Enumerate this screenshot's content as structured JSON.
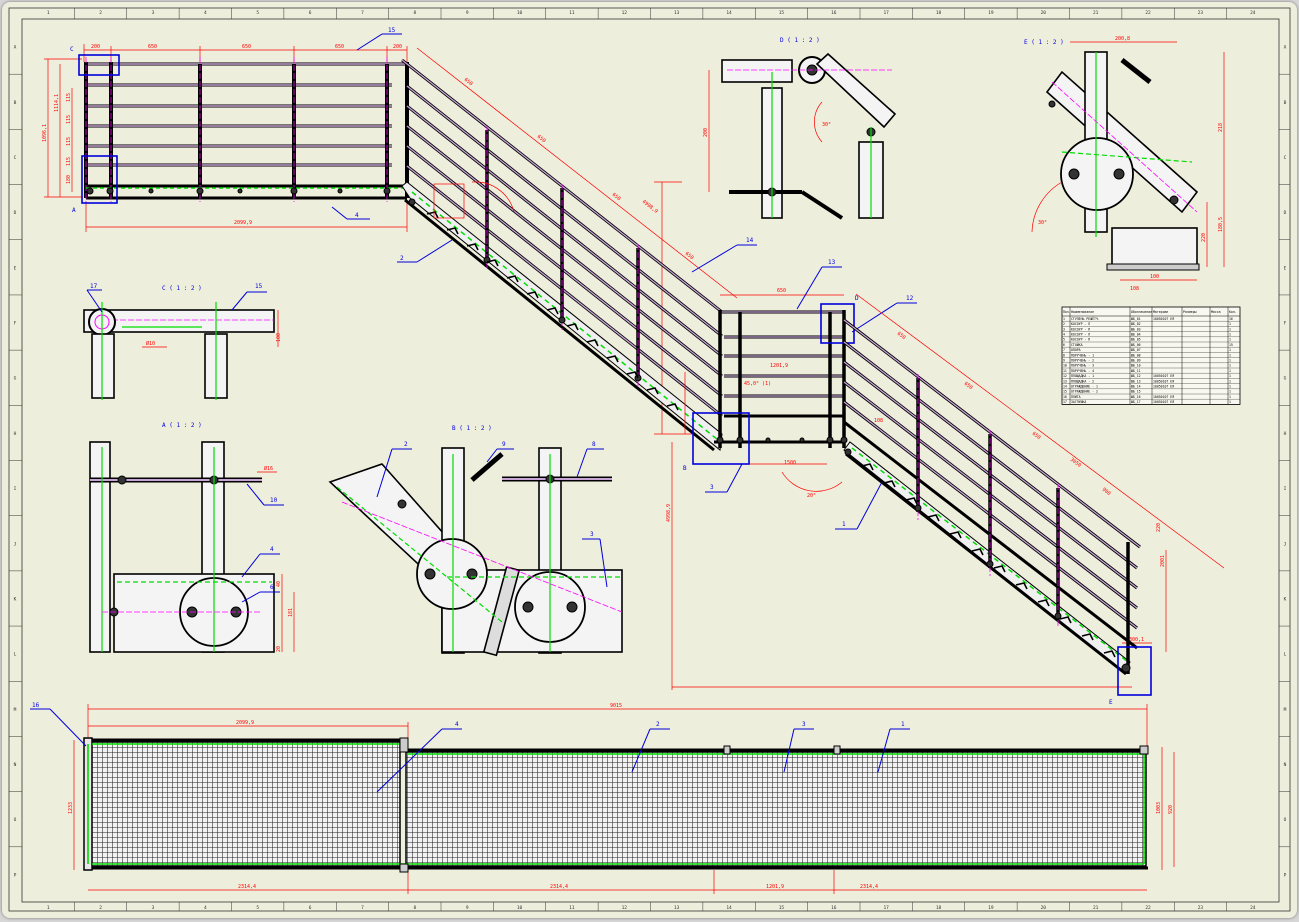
{
  "colors": {
    "sheet": "#eeeedc",
    "frame": "#000000",
    "dimension": "#ff0000",
    "centerline": "#ff00ff",
    "weld": "#00dd00",
    "callout": "#0000ff",
    "rail_fill": "#c7a3d6"
  },
  "border": {
    "columns": [
      "1",
      "2",
      "3",
      "4",
      "5",
      "6",
      "7",
      "8",
      "9",
      "10",
      "11",
      "12",
      "13",
      "14",
      "15",
      "16",
      "17",
      "18",
      "19",
      "20",
      "21",
      "22",
      "23",
      "24"
    ],
    "rows": [
      "A",
      "B",
      "C",
      "D",
      "E",
      "F",
      "G",
      "H",
      "I",
      "J",
      "K",
      "L",
      "M",
      "N",
      "O",
      "P"
    ]
  },
  "views": {
    "detail_c": "C ( 1 : 2 )",
    "detail_a": "A ( 1 : 2 )",
    "detail_b": "B ( 1 : 2 )",
    "detail_d": "D ( 1 : 2 )",
    "detail_e": "E ( 1 : 2 )"
  },
  "detail_markers": [
    "C",
    "A",
    "B",
    "D",
    "E"
  ],
  "balloons": {
    "main": [
      "15",
      "4",
      "2",
      "14",
      "13",
      "12",
      "1",
      "3"
    ],
    "detail_c": [
      "17",
      "15"
    ],
    "detail_a": [
      "10",
      "4",
      "6"
    ],
    "detail_b": [
      "2",
      "9",
      "8",
      "3"
    ],
    "plan": [
      "16",
      "4",
      "2",
      "3",
      "1"
    ]
  },
  "dimensions": {
    "top_segments": [
      "200",
      "650",
      "650",
      "650",
      "200"
    ],
    "left_stack": [
      "1096,1",
      "1114,1",
      "115",
      "115",
      "115",
      "115",
      "180"
    ],
    "platform_length": "2099,9",
    "stair_slope": [
      "650",
      "650",
      "650",
      "650",
      "3050",
      "4998,9"
    ],
    "stair_overall_height": "4998,9",
    "mid_landing": [
      "650",
      "1201,9",
      "1500",
      "100"
    ],
    "mid_angle": "45,0° (1)",
    "lower_run": [
      "650",
      "650",
      "650",
      "3050"
    ],
    "lower_misc": [
      "20°",
      "900",
      "108"
    ],
    "end_right": [
      "2001",
      "220"
    ],
    "end_bottom": [
      "300,1"
    ],
    "detail_c_dims": [
      "Ø10",
      "100"
    ],
    "detail_a_dims": [
      "Ø16",
      "40",
      "20",
      "181"
    ],
    "detail_d_dims": [
      "200",
      "30°"
    ],
    "detail_e_dims": [
      "200,8",
      "218",
      "220",
      "100",
      "180,5",
      "108",
      "30°"
    ],
    "plan_total": "9015",
    "plan_top": "2099,9",
    "plan_bottom": [
      "2314,4",
      "2314,4",
      "1201,9",
      "2314,4"
    ],
    "plan_left": "1233",
    "plan_right": [
      "1003",
      "920"
    ]
  },
  "bom": {
    "headers": [
      "Поз.",
      "Наименование",
      "Обозначение",
      "Материал",
      "Размеры",
      "Масса",
      "Кол."
    ],
    "rows": [
      [
        "1",
        "СТУПЕНЬ РЕШЁТЧ.",
        "ШБ_01",
        "10050107 ЕЯ",
        "",
        "",
        "16"
      ],
      [
        "2",
        "КОСОУР - Л",
        "ШБ_02",
        "",
        "",
        "",
        "1"
      ],
      [
        "3",
        "КОСОУР - П",
        "ШБ_03",
        "",
        "",
        "",
        "1"
      ],
      [
        "4",
        "КОСОУР - Л",
        "ШБ_04",
        "",
        "",
        "",
        "1"
      ],
      [
        "5",
        "КОСОУР - П",
        "ШБ_05",
        "",
        "",
        "",
        "1"
      ],
      [
        "6",
        "СТОЙКА",
        "ШБ_06",
        "",
        "",
        "",
        "15"
      ],
      [
        "7",
        "ОПОРА",
        "ШБ_07",
        "",
        "",
        "",
        "1"
      ],
      [
        "8",
        "ПОРУЧЕНЬ - 1",
        "ШБ_08",
        "",
        "",
        "",
        "1"
      ],
      [
        "9",
        "ПОРУЧЕНЬ - 2",
        "ШБ_09",
        "",
        "",
        "",
        "1"
      ],
      [
        "10",
        "ПОРУЧЕНЬ - 3",
        "ШБ_10",
        "",
        "",
        "",
        "1"
      ],
      [
        "11",
        "ПОРУЧЕНЬ - 4",
        "ШБ_11",
        "",
        "",
        "",
        "1"
      ],
      [
        "12",
        "ПЛОЩАДКА - 1",
        "ШБ_12",
        "10050107 ЕЯ",
        "",
        "",
        "1"
      ],
      [
        "13",
        "ПЛОЩАДКА - 2",
        "ШБ_13",
        "10050107 ЕЯ",
        "",
        "",
        "1"
      ],
      [
        "14",
        "ОГРАЖДЕНИЕ - 1",
        "ШБ_14",
        "10050107 ЕЯ",
        "",
        "",
        "1"
      ],
      [
        "15",
        "ОГРАЖДЕНИЕ - 2",
        "ШБ_15",
        "",
        "",
        "",
        "1"
      ],
      [
        "16",
        "ПЛИТА",
        "ШБ_16",
        "10050107 ЕЯ",
        "",
        "",
        "1"
      ],
      [
        "17",
        "ЗАГЛУШКА",
        "ШБ_17",
        "10050107 ЕЯ",
        "",
        "",
        "1"
      ]
    ]
  }
}
